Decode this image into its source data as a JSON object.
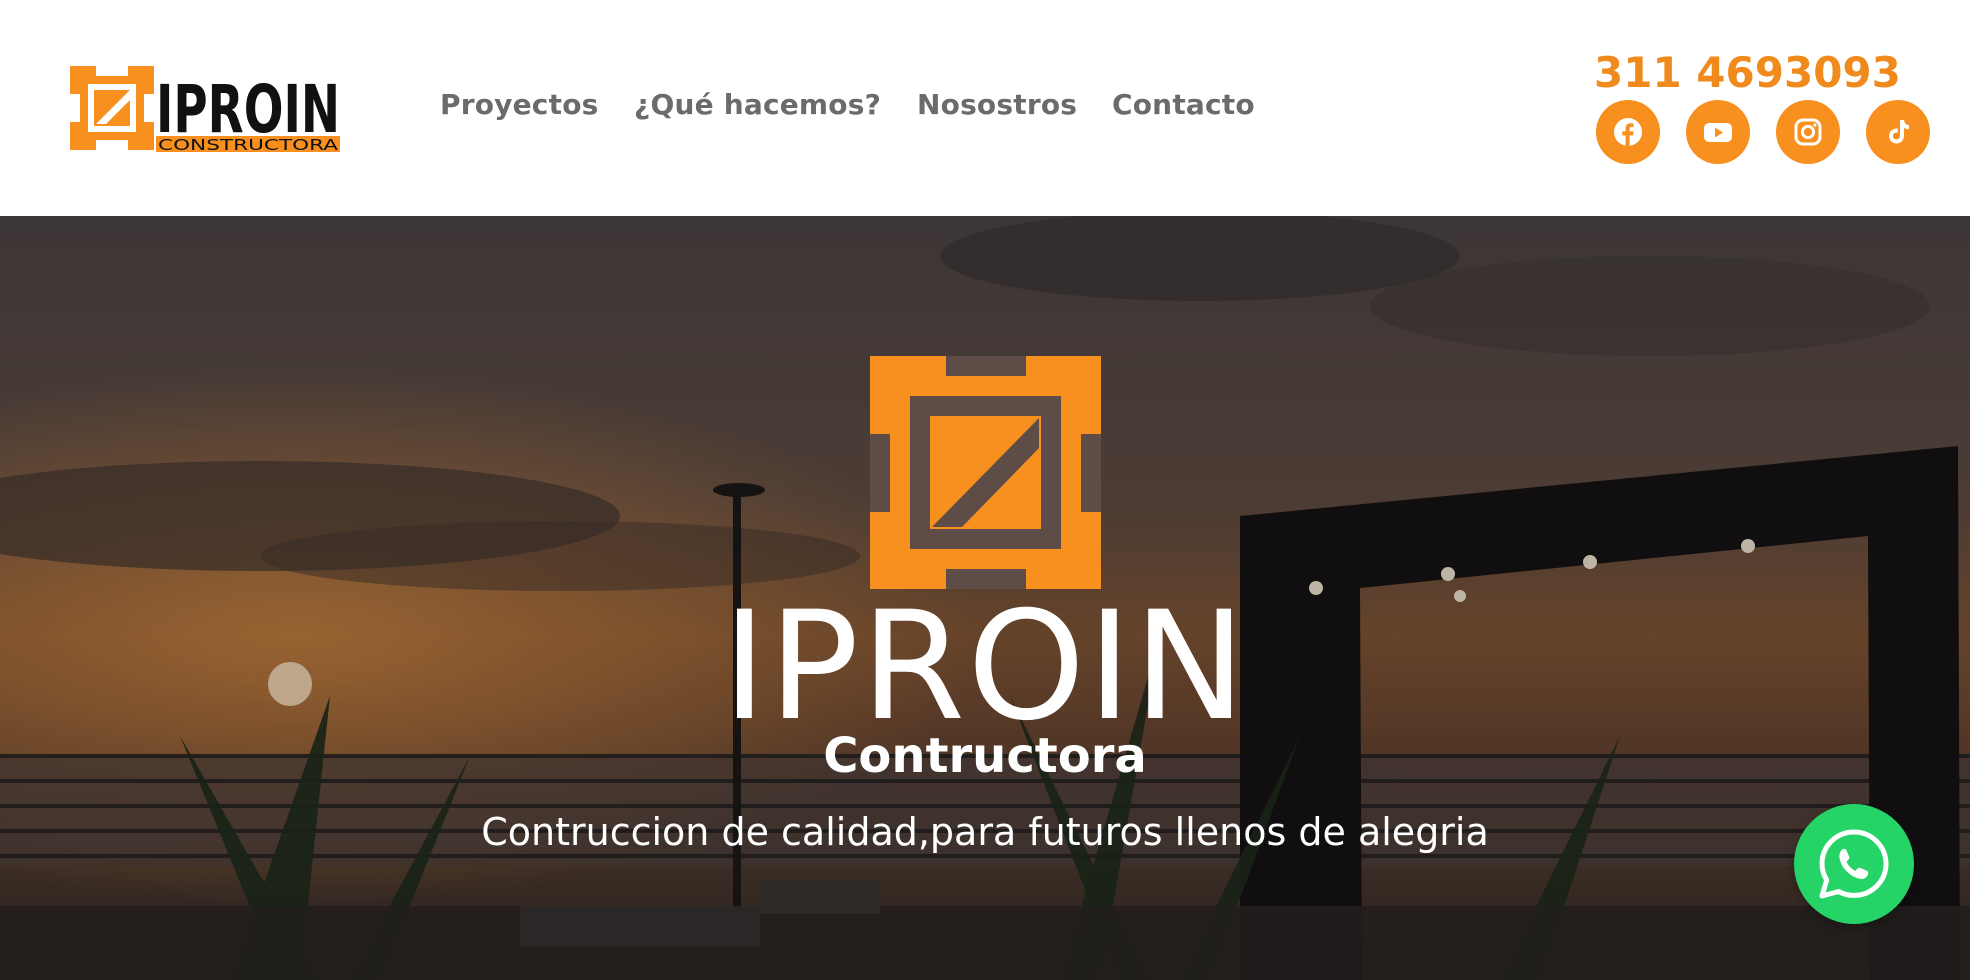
{
  "brand": {
    "logo_name": "IPROIN",
    "logo_subtitle": "CONSTRUCTORA",
    "accent_color": "#f7901e"
  },
  "nav": {
    "items": [
      {
        "label": "Proyectos"
      },
      {
        "label": "¿Qué hacemos?"
      },
      {
        "label": "Nosostros"
      },
      {
        "label": "Contacto"
      }
    ]
  },
  "contact": {
    "phone": "311 4693093"
  },
  "social": [
    {
      "icon": "facebook-icon"
    },
    {
      "icon": "youtube-icon"
    },
    {
      "icon": "instagram-icon"
    },
    {
      "icon": "tiktok-icon"
    }
  ],
  "hero": {
    "title": "IPROIN",
    "subtitle": "Contructora",
    "tagline": "Contruccion de calidad,para futuros llenos de alegria"
  },
  "floating": {
    "whatsapp_icon": "whatsapp-icon",
    "whatsapp_color": "#25d366"
  }
}
